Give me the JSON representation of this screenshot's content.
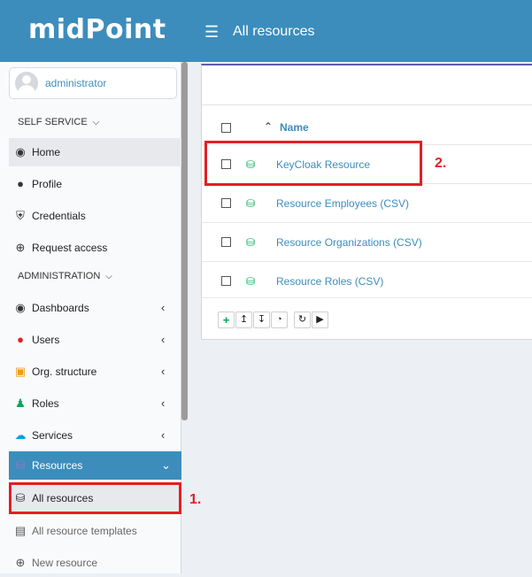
{
  "header": {
    "logo": "midPoint",
    "title": "All resources"
  },
  "user": {
    "name": "administrator"
  },
  "sidebar": {
    "self_service_label": "SELF SERVICE",
    "self_service_items": [
      {
        "label": "Home",
        "icon": "dashboard-icon"
      },
      {
        "label": "Profile",
        "icon": "user-icon"
      },
      {
        "label": "Credentials",
        "icon": "shield-icon"
      },
      {
        "label": "Request access",
        "icon": "plus-circle-icon"
      }
    ],
    "administration_label": "ADMINISTRATION",
    "admin_items": [
      {
        "label": "Dashboards",
        "icon": "dashboard-icon"
      },
      {
        "label": "Users",
        "icon": "user-icon"
      },
      {
        "label": "Org. structure",
        "icon": "building-icon"
      },
      {
        "label": "Roles",
        "icon": "street-view-icon"
      },
      {
        "label": "Services",
        "icon": "cloud-icon"
      }
    ],
    "resources": {
      "label": "Resources",
      "items": [
        {
          "label": "All resources"
        },
        {
          "label": "All resource templates"
        },
        {
          "label": "New resource"
        }
      ]
    }
  },
  "table": {
    "header_name": "Name",
    "rows": [
      "KeyCloak Resource",
      "Resource Employees (CSV)",
      "Resource Organizations (CSV)",
      "Resource Roles (CSV)"
    ],
    "toolbar_icons": [
      "plus-icon",
      "upload-icon",
      "download-icon",
      "pie-chart-add-icon",
      "refresh-icon",
      "play-icon"
    ]
  },
  "callouts": {
    "one": "1.",
    "two": "2."
  },
  "colors": {
    "brand": "#3c8dbc",
    "callout": "#e21f26",
    "resource_icon": "#00a65a"
  }
}
